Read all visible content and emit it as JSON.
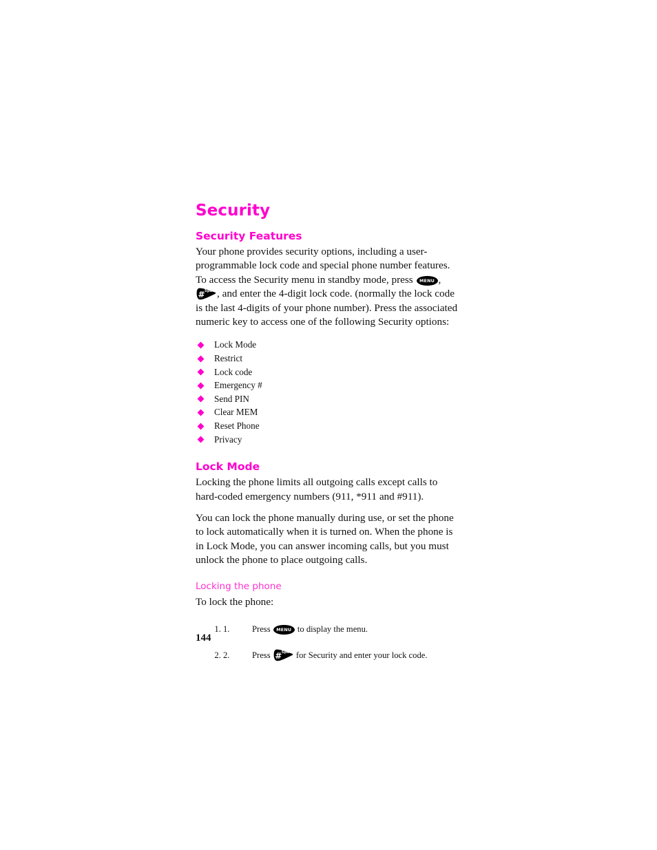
{
  "document": {
    "page_number": "144",
    "accent_color": "#ff00cc",
    "accent_color_light": "#ff2fd0"
  },
  "title": "Security",
  "sections": {
    "security_features": {
      "heading": "Security Features",
      "intro_before_menu_key": "Your phone provides security options, including a user-programmable lock code and special phone number features. To access the Security menu in standby mode, press ",
      "intro_between_keys": ", ",
      "intro_after_keys": ", and enter the 4-digit lock code. (normally the lock code is the last 4-digits of your phone number).  Press the associated numeric key to access one of the following Security options:",
      "options": [
        "Lock Mode",
        "Restrict",
        "Lock code",
        "Emergency #",
        "Send PIN",
        "Clear MEM",
        "Reset Phone",
        "Privacy"
      ]
    },
    "lock_mode": {
      "heading": "Lock Mode",
      "paragraph_1": "Locking the phone limits all outgoing calls except calls to hard-coded emergency numbers (911, *911 and #911).",
      "paragraph_2": "You can lock the phone manually during use, or set the phone to lock automatically when it is turned on. When the phone is in Lock Mode, you can answer incoming calls, but you must unlock the phone to place outgoing calls.",
      "subheading": "Locking the phone",
      "lead_in": "To lock the phone:",
      "steps": [
        {
          "number": "1.",
          "text_before_key": "Press ",
          "key": "MENU",
          "text_after_key": " to display the menu."
        },
        {
          "number": "2.",
          "text_before_key": "Press ",
          "key": "#-Space",
          "text_after_key": " for Security and enter your lock code."
        }
      ]
    }
  },
  "keys": {
    "menu_label": "MENU",
    "hash_label": "#",
    "space_label": "Space"
  }
}
